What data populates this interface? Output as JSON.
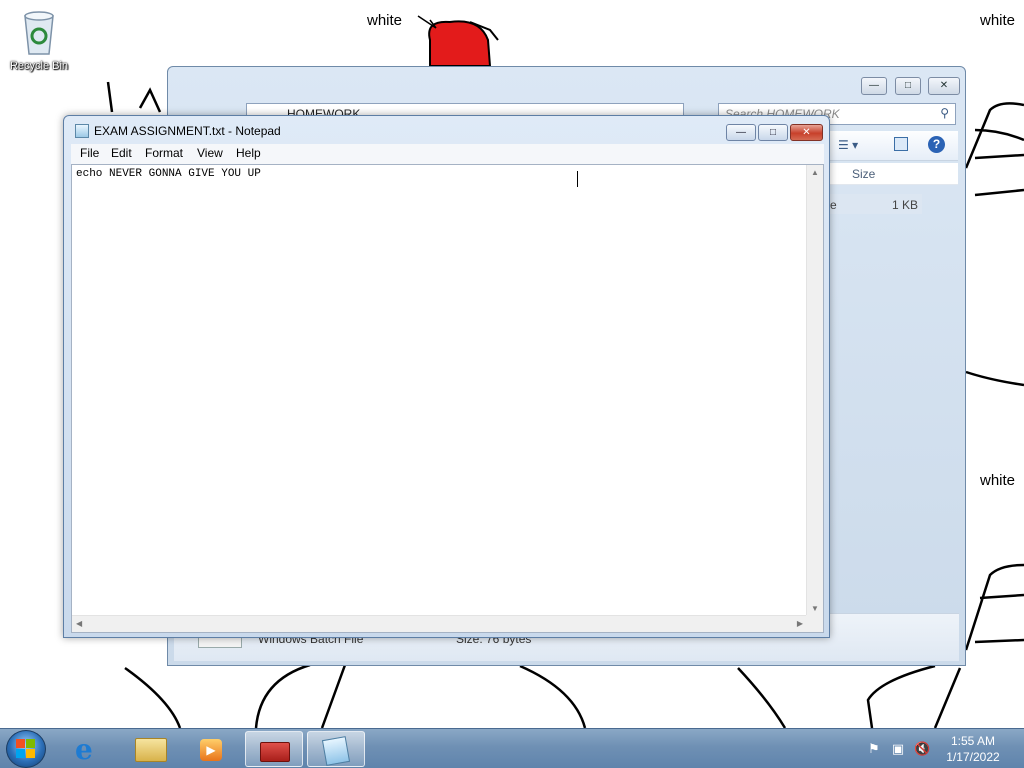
{
  "desktop": {
    "icons": [
      {
        "label": "Recycle Bin",
        "icon": "recycle-bin-icon"
      }
    ],
    "wallpaper_words": [
      "white",
      "white",
      "white"
    ]
  },
  "explorer": {
    "address": "HOMEWORK",
    "search_placeholder": "Search HOMEWORK",
    "column_size": "Size",
    "row_name_fragment": "e",
    "row_size": "1 KB",
    "status_type": "Windows Batch File",
    "status_size": "Size: 76 bytes"
  },
  "notepad": {
    "title": "EXAM ASSIGNMENT.txt - Notepad",
    "menu": [
      "File",
      "Edit",
      "Format",
      "View",
      "Help"
    ],
    "content": "echo NEVER GONNA GIVE YOU UP"
  },
  "taskbar": {
    "apps": [
      "Internet Explorer",
      "Windows Explorer",
      "Windows Media Player",
      "Toolbox",
      "Notepad"
    ],
    "clock_time": "1:55 AM",
    "clock_date": "1/17/2022"
  }
}
